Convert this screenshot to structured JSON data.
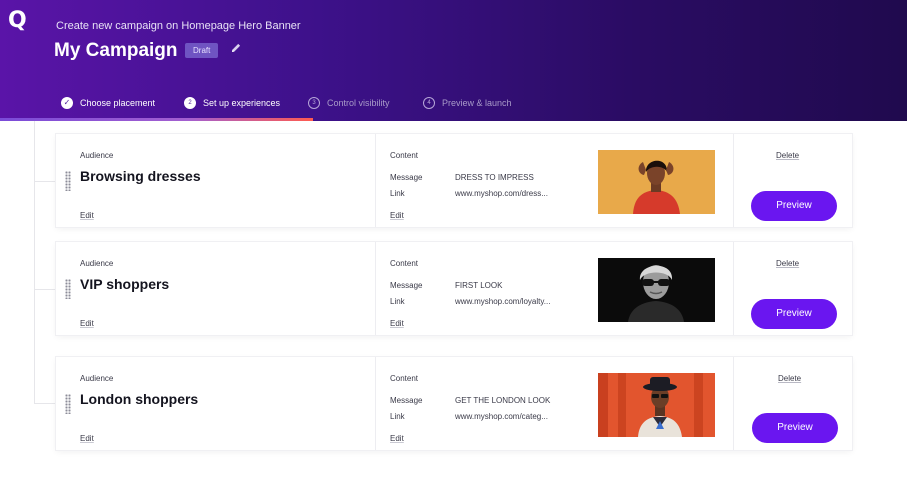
{
  "header": {
    "logo": "Q",
    "subtitle": "Create new campaign on Homepage Hero Banner",
    "title": "My Campaign",
    "badge": "Draft",
    "edit_icon": "pencil-icon"
  },
  "steps": [
    {
      "num": "✓",
      "label": "Choose placement",
      "state": "done"
    },
    {
      "num": "2",
      "label": "Set up experiences",
      "state": "current"
    },
    {
      "num": "3",
      "label": "Control visibility",
      "state": "upcoming"
    },
    {
      "num": "4",
      "label": "Preview & launch",
      "state": "upcoming"
    }
  ],
  "labels": {
    "audience": "Audience",
    "content": "Content",
    "message": "Message",
    "link": "Link",
    "edit": "Edit",
    "delete": "Delete",
    "preview": "Preview"
  },
  "experiences": [
    {
      "audience": "Browsing dresses",
      "message": "DRESS TO IMPRESS",
      "link": "www.myshop.com/dress...",
      "image": "woman-red-dress"
    },
    {
      "audience": "VIP shoppers",
      "message": "FIRST LOOK",
      "link": "www.myshop.com/loyalty...",
      "image": "woman-sunglasses-bw"
    },
    {
      "audience": "London shoppers",
      "message": "GET THE LONDON LOOK",
      "link": "www.myshop.com/categ...",
      "image": "man-hat-orange"
    }
  ],
  "colors": {
    "header_start": "#5a14a8",
    "header_end": "#200a4e",
    "accent": "#6a16f0",
    "progress_end": "#ff5b4f"
  }
}
